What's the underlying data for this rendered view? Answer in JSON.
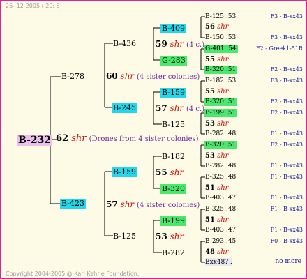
{
  "header": {
    "date": "26- 12-2005 ( 20: 8)",
    "copyright": "Copyright 2004-2005 @ Karl Kehrle Foundation."
  },
  "root": {
    "id": "B-232",
    "num": "62",
    "shr": "shr",
    "note": "(Drones from 4 sister colonies)"
  },
  "gen1": [
    {
      "id": "B-278",
      "num": "60",
      "shr": "shr",
      "note": "(4 sister colonies)"
    },
    {
      "id": "B-423",
      "num": "57",
      "shr": "shr",
      "note": "(4 sister colonies)"
    }
  ],
  "gen2": [
    {
      "id": "B-436",
      "num": "59",
      "shr": "shr",
      "note": "(4 c.)"
    },
    {
      "id": "B-245",
      "num": "57",
      "shr": "shr",
      "note": "(4 c.)"
    },
    {
      "id": "B-159",
      "num": "55",
      "shr": "shr"
    },
    {
      "id": "B-125",
      "num": "53",
      "shr": "shr"
    }
  ],
  "gen3": [
    {
      "id": "B-409",
      "num": "56",
      "shr": "shr"
    },
    {
      "id": "G-283",
      "num": "55",
      "shr": "shr"
    },
    {
      "id": "B-159",
      "num": "55",
      "shr": "shr"
    },
    {
      "id": "B-125",
      "num": "53",
      "shr": "shr"
    },
    {
      "id": "B-182",
      "num": "53",
      "shr": "shr"
    },
    {
      "id": "B-320",
      "num": "51",
      "shr": "shr"
    },
    {
      "id": "B-199",
      "num": "51",
      "shr": "shr"
    },
    {
      "id": "B-282",
      "num": "48",
      "shr": "shr"
    }
  ],
  "gen4": [
    {
      "id": "B-125 .53",
      "r": "F3 - B-xx43"
    },
    {
      "id": "B-150 .53",
      "r": "F3 - B-xx43"
    },
    {
      "id": "G-401 .54",
      "r": "F2 - Greek1-51R"
    },
    {
      "id": "B-320 .51",
      "r": "F2 - B-xx43"
    },
    {
      "id": "B-182 .53",
      "r": "F3 - B-xx43"
    },
    {
      "id": "B-320 .51",
      "r": "F2 - B-xx43"
    },
    {
      "id": "B-199 .51",
      "r": "F2 - B-xx43"
    },
    {
      "id": "B-282 .48",
      "r": "F1 - B-xx43"
    },
    {
      "id": "B-320 .51",
      "r": "F2 - B-xx43"
    },
    {
      "id": "B-282 .48",
      "r": "F1 - B-xx43"
    },
    {
      "id": "B-325 .48",
      "r": "F1 - B-xx43"
    },
    {
      "id": "B-403 .47",
      "r": "F1 - B-xx43"
    },
    {
      "id": "B-325 .48",
      "r": "F1 - B-xx43"
    },
    {
      "id": "B-403 .47",
      "r": "F1 - B-xx43"
    },
    {
      "id": "B-293 .45",
      "r": "F0 - B-xx43"
    },
    {
      "id": "Bxx48? .",
      "r": "no more"
    }
  ],
  "colors": {
    "border": "#e0239a",
    "pink": "#ecc0ec",
    "cyan": "#22d8ea",
    "green": "#4be86e",
    "red": "#d01010",
    "purple": "#6a2c9a",
    "blue": "#1a1aa0"
  }
}
